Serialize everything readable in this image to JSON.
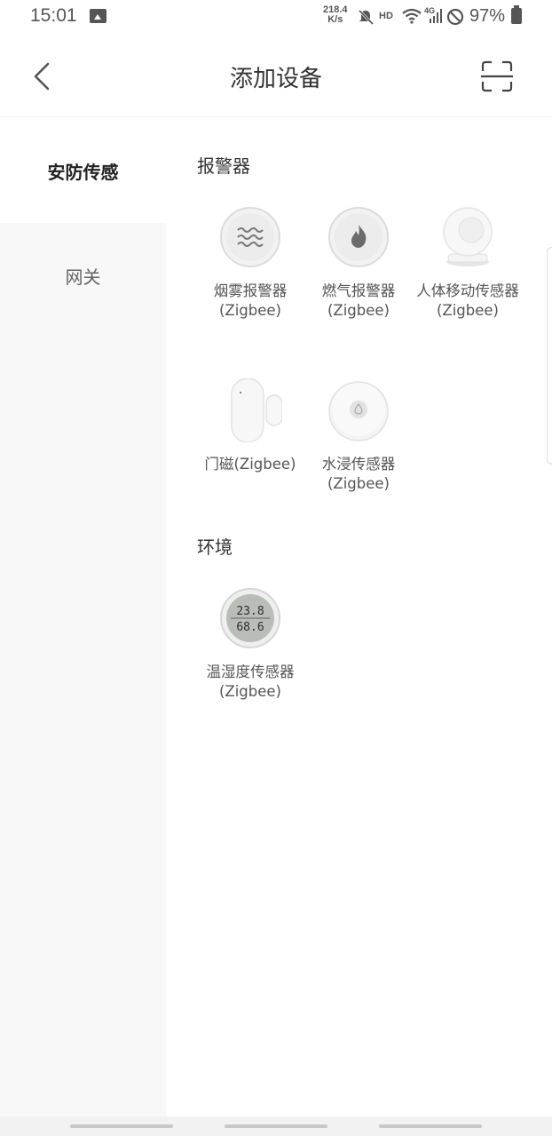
{
  "status_bar": {
    "time": "15:01",
    "net_speed_value": "218.4",
    "net_speed_unit": "K/s",
    "hd": "HD",
    "network_type": "4G",
    "battery": "97%",
    "icons": [
      "image-icon",
      "mute-icon",
      "wifi-icon",
      "signal-icon",
      "do-not-disturb-icon",
      "battery-icon"
    ]
  },
  "header": {
    "title": "添加设备",
    "back_icon": "chevron-left-icon",
    "scan_icon": "scan-icon"
  },
  "sidebar": {
    "items": [
      {
        "label": "安防传感",
        "active": true
      },
      {
        "label": "网关",
        "active": false
      }
    ]
  },
  "sections": [
    {
      "title": "报警器",
      "devices": [
        {
          "name": "烟雾报警器(Zigbee)",
          "icon": "smoke-detector-icon"
        },
        {
          "name": "燃气报警器(Zigbee)",
          "icon": "gas-detector-icon"
        },
        {
          "name": "人体移动传感器(Zigbee)",
          "icon": "motion-sensor-icon"
        },
        {
          "name": "门磁(Zigbee)",
          "icon": "door-sensor-icon"
        },
        {
          "name": "水浸传感器(Zigbee)",
          "icon": "water-leak-sensor-icon"
        }
      ]
    },
    {
      "title": "环境",
      "devices": [
        {
          "name": "温湿度传感器(Zigbee)",
          "icon": "temp-humidity-sensor-icon",
          "display_top": "23.8",
          "display_bottom": "68.6"
        }
      ]
    }
  ],
  "colors": {
    "sidebar_bg": "#f8f8f8",
    "active_text": "#222222",
    "inactive_text": "#666666",
    "device_text": "#555555"
  }
}
